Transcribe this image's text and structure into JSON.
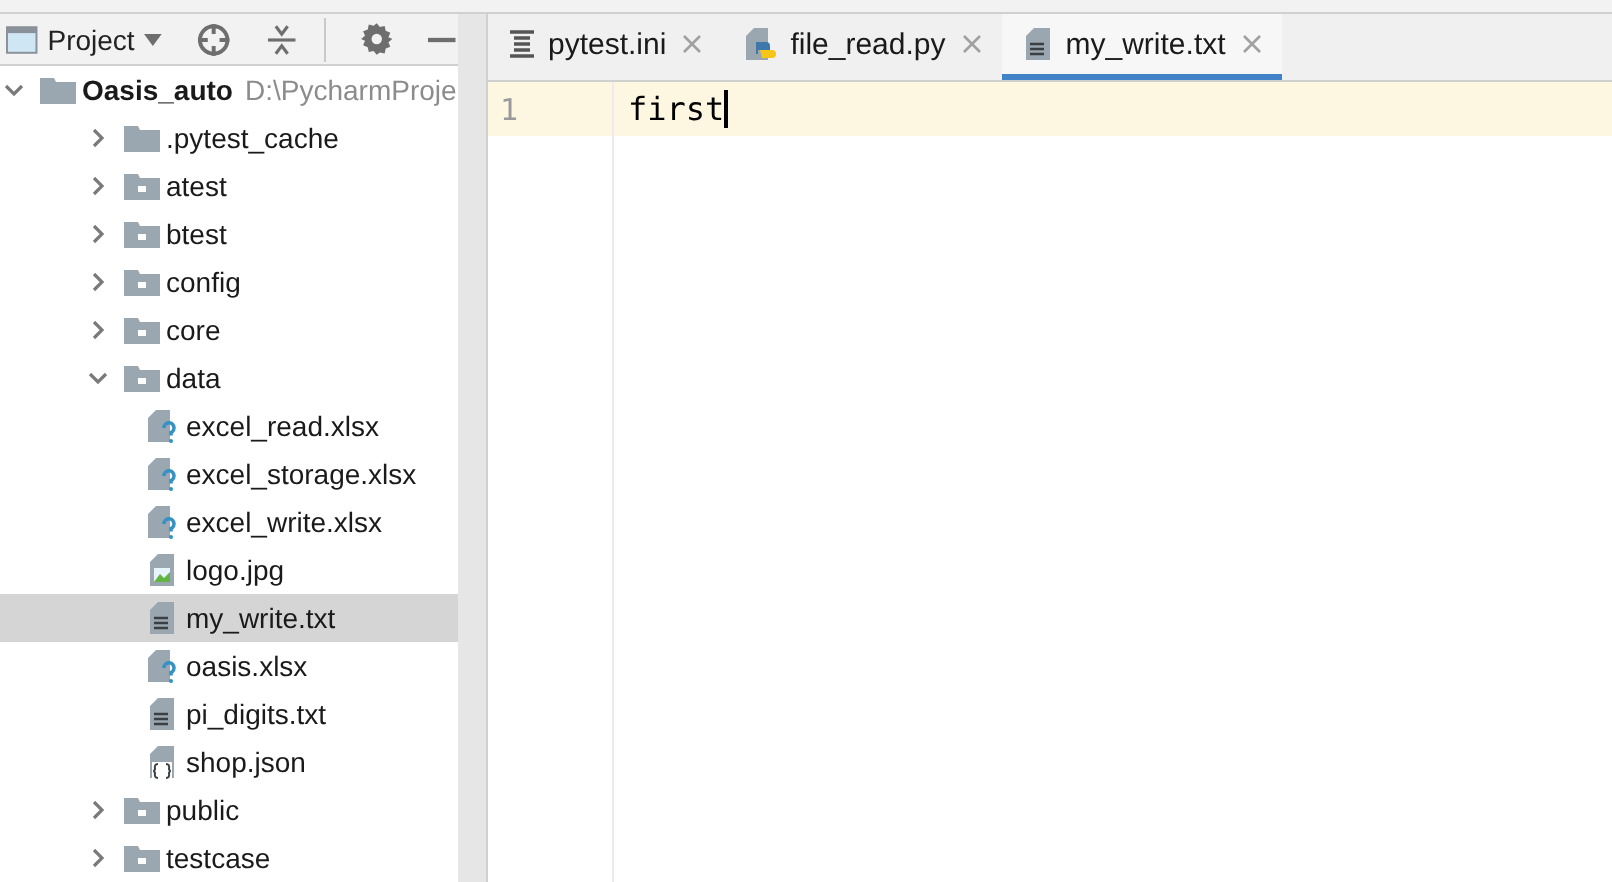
{
  "project_panel": {
    "title": "Project"
  },
  "tabs": [
    {
      "label": "pytest.ini",
      "kind": "ini",
      "selected": false
    },
    {
      "label": "file_read.py",
      "kind": "python",
      "selected": false
    },
    {
      "label": "my_write.txt",
      "kind": "text",
      "selected": true
    }
  ],
  "tree": [
    {
      "label": "Oasis_auto",
      "path": "D:\\PycharmProje",
      "kind": "root",
      "expanded": true,
      "selected": false,
      "children": [
        {
          "label": ".pytest_cache",
          "kind": "excluded-folder",
          "expanded": false,
          "selected": false
        },
        {
          "label": "atest",
          "kind": "folder",
          "expanded": false,
          "selected": false
        },
        {
          "label": "btest",
          "kind": "folder",
          "expanded": false,
          "selected": false
        },
        {
          "label": "config",
          "kind": "folder",
          "expanded": false,
          "selected": false
        },
        {
          "label": "core",
          "kind": "folder",
          "expanded": false,
          "selected": false
        },
        {
          "label": "data",
          "kind": "folder",
          "expanded": true,
          "selected": false,
          "children": [
            {
              "label": "excel_read.xlsx",
              "kind": "unknown-file",
              "selected": false
            },
            {
              "label": "excel_storage.xlsx",
              "kind": "unknown-file",
              "selected": false
            },
            {
              "label": "excel_write.xlsx",
              "kind": "unknown-file",
              "selected": false
            },
            {
              "label": "logo.jpg",
              "kind": "image-file",
              "selected": false
            },
            {
              "label": "my_write.txt",
              "kind": "text-file",
              "selected": true
            },
            {
              "label": "oasis.xlsx",
              "kind": "unknown-file",
              "selected": false
            },
            {
              "label": "pi_digits.txt",
              "kind": "text-file",
              "selected": false
            },
            {
              "label": "shop.json",
              "kind": "json-file",
              "selected": false
            }
          ]
        },
        {
          "label": "public",
          "kind": "folder",
          "expanded": false,
          "selected": false
        },
        {
          "label": "testcase",
          "kind": "folder",
          "expanded": false,
          "selected": false
        }
      ]
    }
  ],
  "editor": {
    "lines": [
      {
        "number": "1",
        "text": "first",
        "current": true
      }
    ]
  }
}
